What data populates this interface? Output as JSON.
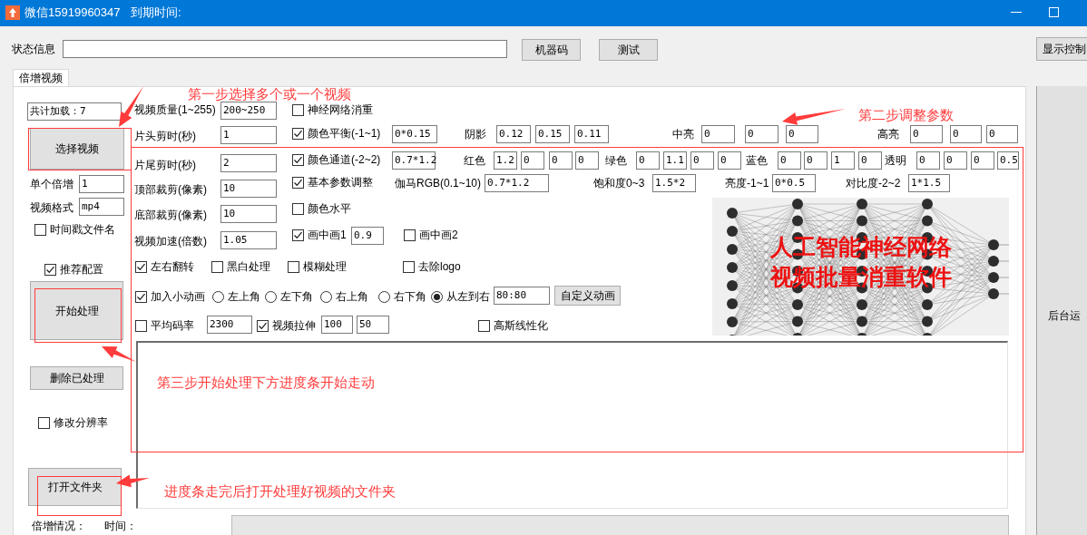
{
  "window": {
    "title": "微信15919960347",
    "expiry_label": "到期时间:"
  },
  "tabs": [
    {
      "label": "倍增视频",
      "selected": true
    }
  ],
  "controls": [
    {
      "kind": "label",
      "text": "状态信息"
    },
    {
      "kind": "input"
    },
    {
      "kind": "button",
      "text": "机器码"
    },
    {
      "kind": "button",
      "text": "测试"
    },
    {
      "kind": "button",
      "text": "显示控制"
    },
    {
      "kind": "input",
      "value": "共计加载：7"
    },
    {
      "kind": "button",
      "text": "选择视频"
    },
    {
      "kind": "label",
      "text": "单个倍增"
    },
    {
      "kind": "input",
      "value": "1"
    },
    {
      "kind": "label",
      "text": "视频格式"
    },
    {
      "kind": "input",
      "value": "mp4"
    },
    {
      "kind": "checkbox",
      "text": "时间戳文件名",
      "checked": false
    },
    {
      "kind": "checkbox",
      "text": "推荐配置",
      "checked": true
    },
    {
      "kind": "button",
      "text": "开始处理"
    },
    {
      "kind": "button",
      "text": "删除已处理"
    },
    {
      "kind": "checkbox",
      "text": "修改分辨率",
      "checked": false
    },
    {
      "kind": "button",
      "text": "打开文件夹"
    },
    {
      "kind": "label",
      "text": "倍增情况："
    },
    {
      "kind": "label",
      "text": "时间："
    },
    {
      "kind": "label",
      "text": "视频质量(1~255)"
    },
    {
      "kind": "input",
      "value": "200~250"
    },
    {
      "kind": "label",
      "text": "片头剪时(秒)"
    },
    {
      "kind": "input",
      "value": "1"
    },
    {
      "kind": "label",
      "text": "片尾剪时(秒)"
    },
    {
      "kind": "input",
      "value": "2"
    },
    {
      "kind": "label",
      "text": "顶部裁剪(像素)"
    },
    {
      "kind": "input",
      "value": "10"
    },
    {
      "kind": "label",
      "text": "底部裁剪(像素)"
    },
    {
      "kind": "input",
      "value": "10"
    },
    {
      "kind": "label",
      "text": "视频加速(倍数)"
    },
    {
      "kind": "input",
      "value": "1.05"
    },
    {
      "kind": "checkbox",
      "text": "神经网络消重",
      "checked": false
    },
    {
      "kind": "checkbox",
      "text": "颜色平衡(-1~1)",
      "checked": true
    },
    {
      "kind": "input",
      "value": "0*0.15"
    },
    {
      "kind": "label",
      "text": "阴影"
    },
    {
      "kind": "input",
      "value": "0.12"
    },
    {
      "kind": "input",
      "value": "0.15"
    },
    {
      "kind": "input",
      "value": "0.11"
    },
    {
      "kind": "label",
      "text": "中亮"
    },
    {
      "kind": "input",
      "value": "0"
    },
    {
      "kind": "input",
      "value": "0"
    },
    {
      "kind": "input",
      "value": "0"
    },
    {
      "kind": "label",
      "text": "高亮"
    },
    {
      "kind": "input",
      "value": "0"
    },
    {
      "kind": "input",
      "value": "0"
    },
    {
      "kind": "input",
      "value": "0"
    },
    {
      "kind": "checkbox",
      "text": "颜色通道(-2~2)",
      "checked": true
    },
    {
      "kind": "input",
      "value": "0.7*1.2"
    },
    {
      "kind": "label",
      "text": "红色"
    },
    {
      "kind": "input",
      "value": "1.2"
    },
    {
      "kind": "input",
      "value": "0"
    },
    {
      "kind": "input",
      "value": "0"
    },
    {
      "kind": "input",
      "value": "0"
    },
    {
      "kind": "label",
      "text": "绿色"
    },
    {
      "kind": "input",
      "value": "0"
    },
    {
      "kind": "input",
      "value": "1.1"
    },
    {
      "kind": "input",
      "value": "0"
    },
    {
      "kind": "input",
      "value": "0"
    },
    {
      "kind": "label",
      "text": "蓝色"
    },
    {
      "kind": "input",
      "value": "0"
    },
    {
      "kind": "input",
      "value": "0"
    },
    {
      "kind": "input",
      "value": "1"
    },
    {
      "kind": "input",
      "value": "0"
    },
    {
      "kind": "label",
      "text": "透明"
    },
    {
      "kind": "input",
      "value": "0"
    },
    {
      "kind": "input",
      "value": "0"
    },
    {
      "kind": "input",
      "value": "0"
    },
    {
      "kind": "input",
      "value": "0.5"
    },
    {
      "kind": "checkbox",
      "text": "基本参数调整",
      "checked": true
    },
    {
      "kind": "label",
      "text": "伽马RGB(0.1~10)"
    },
    {
      "kind": "input",
      "value": "0.7*1.2"
    },
    {
      "kind": "label",
      "text": "饱和度0~3"
    },
    {
      "kind": "input",
      "value": "1.5*2"
    },
    {
      "kind": "label",
      "text": "亮度-1~1"
    },
    {
      "kind": "input",
      "value": "0*0.5"
    },
    {
      "kind": "label",
      "text": "对比度-2~2"
    },
    {
      "kind": "input",
      "value": "1*1.5"
    },
    {
      "kind": "checkbox",
      "text": "颜色水平",
      "checked": false
    },
    {
      "kind": "checkbox",
      "text": "画中画1",
      "checked": true
    },
    {
      "kind": "input",
      "value": "0.9"
    },
    {
      "kind": "checkbox",
      "text": "画中画2",
      "checked": false
    },
    {
      "kind": "checkbox",
      "text": "左右翻转",
      "checked": true
    },
    {
      "kind": "checkbox",
      "text": "黑白处理",
      "checked": false
    },
    {
      "kind": "checkbox",
      "text": "模糊处理",
      "checked": false
    },
    {
      "kind": "checkbox",
      "text": "去除logo",
      "checked": false
    },
    {
      "kind": "checkbox",
      "text": "加入小动画",
      "checked": true
    },
    {
      "kind": "radio",
      "text": "左上角",
      "selected": false
    },
    {
      "kind": "radio",
      "text": "左下角",
      "selected": false
    },
    {
      "kind": "radio",
      "text": "右上角",
      "selected": false
    },
    {
      "kind": "radio",
      "text": "右下角",
      "selected": false
    },
    {
      "kind": "radio",
      "text": "从左到右",
      "selected": true
    },
    {
      "kind": "input",
      "value": "80:80"
    },
    {
      "kind": "button",
      "text": "自定义动画"
    },
    {
      "kind": "checkbox",
      "text": "平均码率",
      "checked": false
    },
    {
      "kind": "input",
      "value": "2300"
    },
    {
      "kind": "checkbox",
      "text": "视频拉伸",
      "checked": true
    },
    {
      "kind": "input",
      "value": "100"
    },
    {
      "kind": "input",
      "value": "50"
    },
    {
      "kind": "checkbox",
      "text": "高斯线性化",
      "checked": false
    }
  ],
  "banner": [
    "人工智能神经网络",
    "视频批量消重软件"
  ],
  "progress": {
    "level": 0
  },
  "side_panel": {
    "label": "后台运"
  },
  "annotations": [
    {
      "text": "第一步选择多个或一个视频"
    },
    {
      "text": "第二步调整参数"
    },
    {
      "text": "第三步开始处理下方进度条开始走动"
    },
    {
      "text": "进度条走完后打开处理好视频的文件夹"
    }
  ]
}
